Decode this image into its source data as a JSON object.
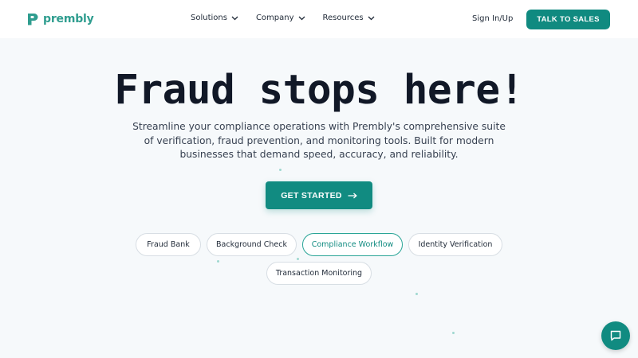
{
  "brand": {
    "name": "prembly",
    "accent_color": "#118b81",
    "logo_icon": "prembly-logo-mark"
  },
  "nav": {
    "items": [
      {
        "label": "Solutions",
        "icon": "chevron-down-icon"
      },
      {
        "label": "Company",
        "icon": "chevron-down-icon"
      },
      {
        "label": "Resources",
        "icon": "chevron-down-icon"
      }
    ],
    "signin_label": "Sign In/Up",
    "cta_label": "TALK TO SALES"
  },
  "hero": {
    "title": "Fraud stops here!",
    "subtitle": "Streamline your compliance operations with Prembly's comprehensive suite of verification, fraud prevention, and monitoring tools. Built for modern businesses that demand speed, accuracy, and reliability.",
    "cta_label": "GET STARTED",
    "cta_icon": "arrow-right-icon"
  },
  "pills": [
    {
      "label": "Fraud Bank",
      "active": false
    },
    {
      "label": "Background Check",
      "active": false
    },
    {
      "label": "Compliance Workflow",
      "active": true
    },
    {
      "label": "Identity Verification",
      "active": false
    },
    {
      "label": "Transaction Monitoring",
      "active": false
    }
  ],
  "chat": {
    "icon": "chat-bubble-icon"
  }
}
